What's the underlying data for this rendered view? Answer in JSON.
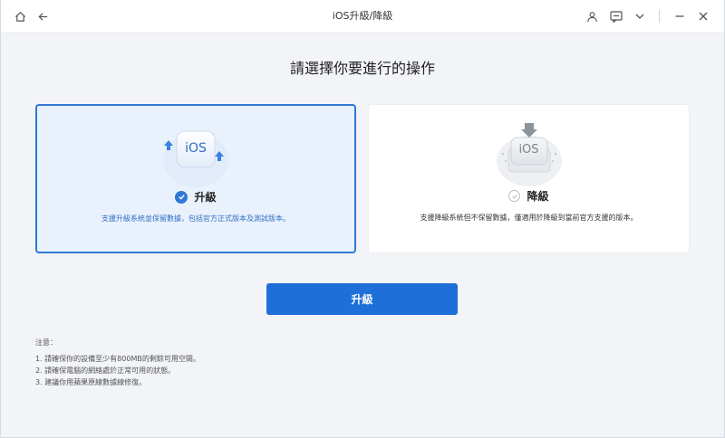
{
  "window": {
    "title": "iOS升級/降級"
  },
  "titlebar_icons": {
    "left": [
      "home-icon",
      "back-arrow-icon"
    ],
    "right": [
      "user-icon",
      "feedback-icon",
      "chevron-down-icon",
      "minimize-icon",
      "close-icon"
    ]
  },
  "main": {
    "heading": "請選擇你要進行的操作",
    "options": [
      {
        "id": "upgrade",
        "label": "升級",
        "badge": "iOS",
        "description": "支援升級系統並保留數據，包括官方正式版本及測試版本。",
        "selected": true
      },
      {
        "id": "downgrade",
        "label": "降級",
        "badge": "iOS",
        "description": "支援降級系統但不保留數據，僅適用於降級到當前官方支援的版本。",
        "selected": false
      }
    ],
    "primary_button": "升級"
  },
  "notes": {
    "title": "注意：",
    "items": [
      "1.  請確保你的設備至少有800MB的剩餘可用空間。",
      "2.  請確保電腦的網絡處於正常可用的狀態。",
      "3.  建議你用蘋果原線數據線修復。"
    ]
  },
  "colors": {
    "accent": "#1f6fd8",
    "selected_card_bg": "#e9f1fc",
    "selected_border": "#2f78d6",
    "page_bg": "#f2f4f8"
  }
}
